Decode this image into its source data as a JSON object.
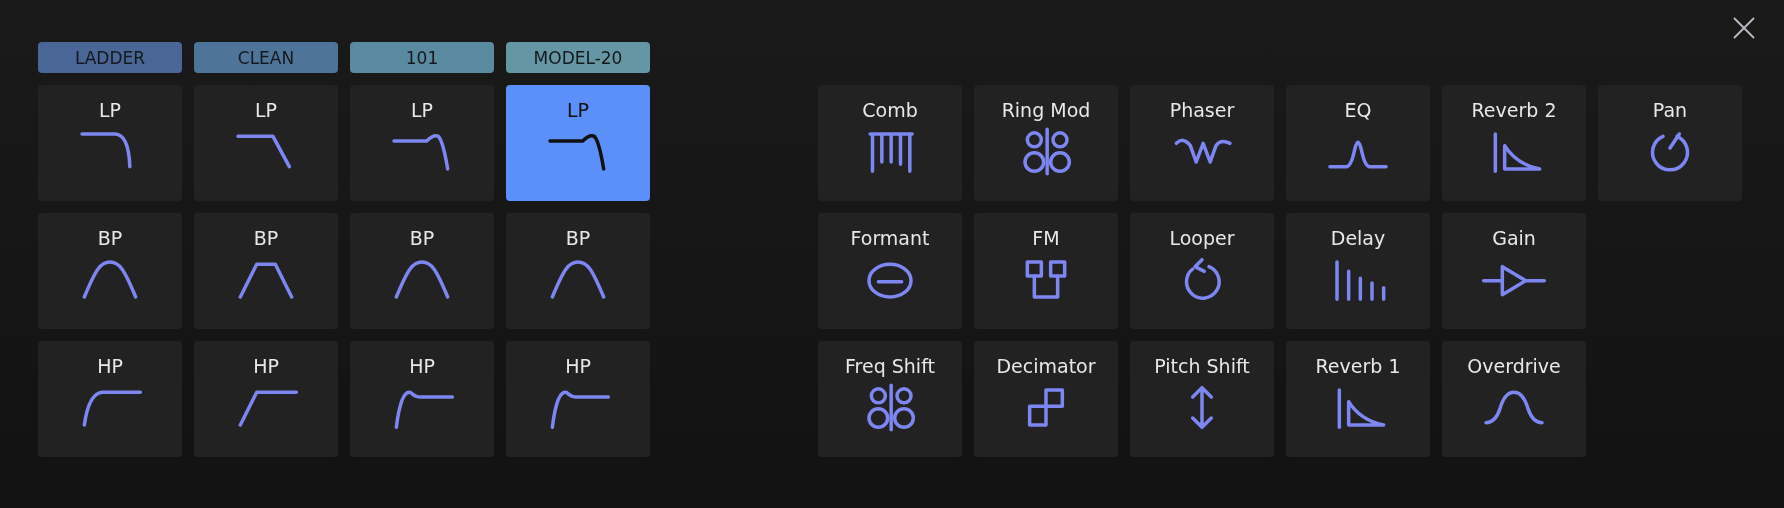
{
  "filters": [
    {
      "label": "LADDER",
      "color": "#4a6696",
      "kind": "smooth",
      "slots": [
        {
          "label": "LP",
          "kind": "lp",
          "selected": false
        },
        {
          "label": "BP",
          "kind": "bp",
          "selected": false
        },
        {
          "label": "HP",
          "kind": "hp",
          "selected": false
        }
      ]
    },
    {
      "label": "CLEAN",
      "color": "#4e7599",
      "kind": "linear",
      "slots": [
        {
          "label": "LP",
          "kind": "lp",
          "selected": false
        },
        {
          "label": "BP",
          "kind": "bp",
          "selected": false
        },
        {
          "label": "HP",
          "kind": "hp",
          "selected": false
        }
      ]
    },
    {
      "label": "101",
      "color": "#5a8aa0",
      "kind": "resonant",
      "slots": [
        {
          "label": "LP",
          "kind": "lp",
          "selected": false
        },
        {
          "label": "BP",
          "kind": "bp",
          "selected": false
        },
        {
          "label": "HP",
          "kind": "hp",
          "selected": false
        }
      ]
    },
    {
      "label": "MODEL-20",
      "color": "#6497a3",
      "kind": "resonant",
      "slots": [
        {
          "label": "LP",
          "kind": "lp",
          "selected": true
        },
        {
          "label": "BP",
          "kind": "bp",
          "selected": false
        },
        {
          "label": "HP",
          "kind": "hp",
          "selected": false
        }
      ]
    }
  ],
  "effect_rows": [
    [
      {
        "label": "Comb",
        "kind": "comb"
      },
      {
        "label": "Ring Mod",
        "kind": "ring"
      },
      {
        "label": "Phaser",
        "kind": "phaser"
      },
      {
        "label": "EQ",
        "kind": "eq"
      },
      {
        "label": "Reverb 2",
        "kind": "reverb"
      },
      {
        "label": "Pan",
        "kind": "pan"
      }
    ],
    [
      {
        "label": "Formant",
        "kind": "formant"
      },
      {
        "label": "FM",
        "kind": "fm"
      },
      {
        "label": "Looper",
        "kind": "looper"
      },
      {
        "label": "Delay",
        "kind": "delay"
      },
      {
        "label": "Gain",
        "kind": "gain"
      }
    ],
    [
      {
        "label": "Freq Shift",
        "kind": "ring"
      },
      {
        "label": "Decimator",
        "kind": "decimator"
      },
      {
        "label": "Pitch Shift",
        "kind": "pitch"
      },
      {
        "label": "Reverb 1",
        "kind": "reverb"
      },
      {
        "label": "Overdrive",
        "kind": "overdrive"
      }
    ]
  ]
}
